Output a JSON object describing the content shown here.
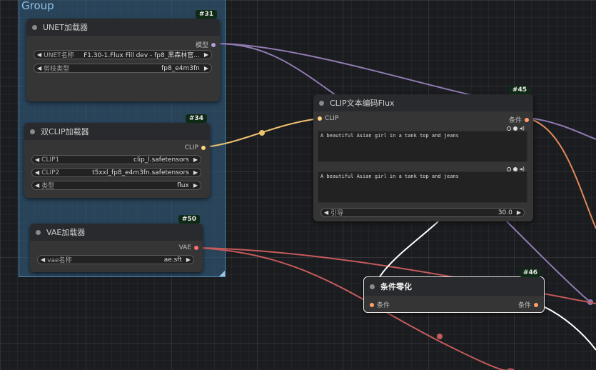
{
  "group": {
    "title": "Group"
  },
  "nodes": {
    "unet": {
      "id": "#31",
      "title": "UNET加载器",
      "output": "模型",
      "widgets": [
        {
          "label": "UNET名称",
          "value": "F1.30-1.Flux Fill dev - fp8_黑森林官..."
        },
        {
          "label": "剪枝类型",
          "value": "fp8_e4m3fn"
        }
      ]
    },
    "dualclip": {
      "id": "#34",
      "title": "双CLIP加载器",
      "output": "CLIP",
      "widgets": [
        {
          "label": "CLIP1",
          "value": "clip_l.safetensors"
        },
        {
          "label": "CLIP2",
          "value": "t5xxl_fp8_e4m3fn.safetensors"
        },
        {
          "label": "类型",
          "value": "flux"
        }
      ]
    },
    "vae": {
      "id": "#50",
      "title": "VAE加载器",
      "output": "VAE",
      "widgets": [
        {
          "label": "vae名称",
          "value": "ae.sft"
        }
      ]
    },
    "clipenc": {
      "id": "#45",
      "title": "CLIP文本编码Flux",
      "input": "CLIP",
      "output": "条件",
      "text1": "A beautiful Asian girl in a tank top and jeans",
      "text2": "A beautiful Asian girl in a tank top and jeans",
      "widgets": [
        {
          "label": "引导",
          "value": "30.0"
        }
      ]
    },
    "zero": {
      "id": "#46",
      "title": "条件零化",
      "input": "条件",
      "output": "条件"
    }
  },
  "colors": {
    "model": "#b39ddb",
    "clip": "#ffd27f",
    "vae": "#ff6e6e",
    "conditioning": "#ffa06a",
    "link_white": "#ffffff",
    "group": "#3f789e"
  }
}
